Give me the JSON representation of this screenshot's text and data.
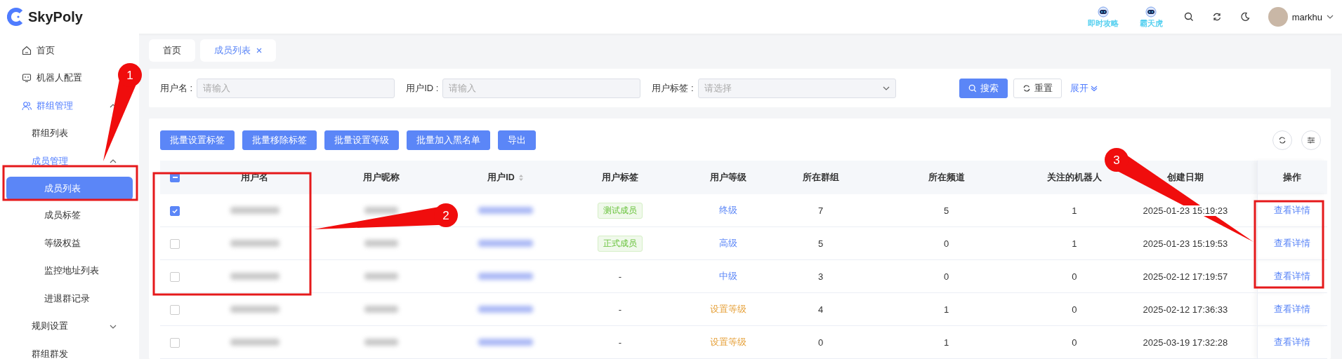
{
  "app": {
    "logo_text": "SkyPoly"
  },
  "header": {
    "banners": [
      {
        "label": "即时攻略"
      },
      {
        "label": "霸天虎"
      }
    ],
    "user": {
      "name": "markhu"
    }
  },
  "sidebar": {
    "items": [
      {
        "label": "首页",
        "selected": false
      },
      {
        "label": "机器人配置",
        "selected": false
      },
      {
        "label": "群组管理",
        "expanded": true,
        "children": [
          {
            "label": "群组列表",
            "selected": false
          },
          {
            "label": "成员管理",
            "expanded": true,
            "children": [
              {
                "label": "成员列表",
                "selected": true
              },
              {
                "label": "成员标签",
                "selected": false
              },
              {
                "label": "等级权益",
                "selected": false
              },
              {
                "label": "监控地址列表",
                "selected": false
              },
              {
                "label": "进退群记录",
                "selected": false
              }
            ]
          },
          {
            "label": "规则设置",
            "expanded": false
          },
          {
            "label": "群组群发",
            "selected": false
          }
        ]
      }
    ]
  },
  "tabs": [
    {
      "label": "首页",
      "selected": false,
      "closable": false
    },
    {
      "label": "成员列表",
      "selected": true,
      "closable": true
    }
  ],
  "filters": [
    {
      "label": "用户名 :",
      "placeholder": "请输入",
      "kind": "input"
    },
    {
      "label": "用户ID :",
      "placeholder": "请输入",
      "kind": "input"
    },
    {
      "label": "用户标签 :",
      "placeholder": "请选择",
      "kind": "select"
    }
  ],
  "filter_actions": {
    "search": "搜索",
    "reset": "重置",
    "expand": "展开"
  },
  "batch_buttons": [
    "批量设置标签",
    "批量移除标签",
    "批量设置等级",
    "批量加入黑名单",
    "导出"
  ],
  "table": {
    "columns": [
      {
        "label": "用户名",
        "sortable": false
      },
      {
        "label": "用户昵称",
        "sortable": false
      },
      {
        "label": "用户ID",
        "sortable": true
      },
      {
        "label": "用户标签",
        "sortable": false
      },
      {
        "label": "用户等级",
        "sortable": false
      },
      {
        "label": "所在群组",
        "sortable": false
      },
      {
        "label": "所在频道",
        "sortable": false
      },
      {
        "label": "关注的机器人",
        "sortable": false
      },
      {
        "label": "创建日期",
        "sortable": false
      },
      {
        "label": "操作",
        "sortable": false
      }
    ],
    "rows": [
      {
        "checked": true,
        "tag": {
          "text": "测试成员",
          "kind": "tag"
        },
        "level": {
          "text": "终级",
          "kind": "set"
        },
        "groups": "7",
        "channels": "5",
        "robots": "1",
        "created": "2025-01-23 15:19:23",
        "action": "查看详情"
      },
      {
        "checked": false,
        "tag": {
          "text": "正式成员",
          "kind": "tag"
        },
        "level": {
          "text": "高级",
          "kind": "set"
        },
        "groups": "5",
        "channels": "0",
        "robots": "1",
        "created": "2025-01-23 15:19:53",
        "action": "查看详情"
      },
      {
        "checked": false,
        "tag": {
          "text": "-",
          "kind": "plain"
        },
        "level": {
          "text": "中级",
          "kind": "set"
        },
        "groups": "3",
        "channels": "0",
        "robots": "0",
        "created": "2025-02-12 17:19:57",
        "action": "查看详情"
      },
      {
        "checked": false,
        "tag": {
          "text": "-",
          "kind": "plain"
        },
        "level": {
          "text": "设置等级",
          "kind": "unset"
        },
        "groups": "4",
        "channels": "1",
        "robots": "0",
        "created": "2025-02-12 17:36:33",
        "action": "查看详情"
      },
      {
        "checked": false,
        "tag": {
          "text": "-",
          "kind": "plain"
        },
        "level": {
          "text": "设置等级",
          "kind": "unset"
        },
        "groups": "0",
        "channels": "1",
        "robots": "0",
        "created": "2025-03-19 17:32:28",
        "action": "查看详情"
      }
    ]
  },
  "annotations": [
    {
      "label": "1"
    },
    {
      "label": "2"
    },
    {
      "label": "3"
    }
  ]
}
